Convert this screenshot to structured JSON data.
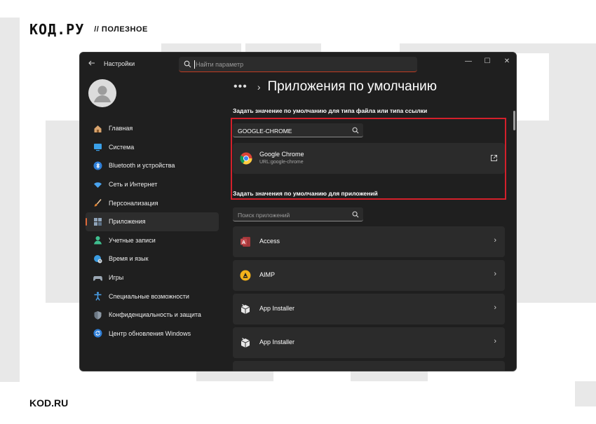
{
  "brand": {
    "logo": "КОД.РУ",
    "tag": "// ПОЛЕЗНОЕ",
    "footer": "KOD.RU"
  },
  "window": {
    "title": "Настройки",
    "search_placeholder": "Найти параметр",
    "controls": {
      "minimize": "—",
      "maximize": "☐",
      "close": "✕"
    }
  },
  "sidebar": {
    "items": [
      {
        "label": "Главная",
        "icon": "home-icon"
      },
      {
        "label": "Система",
        "icon": "monitor-icon"
      },
      {
        "label": "Bluetooth и устройства",
        "icon": "bluetooth-icon"
      },
      {
        "label": "Сеть и Интернет",
        "icon": "wifi-icon"
      },
      {
        "label": "Персонализация",
        "icon": "brush-icon"
      },
      {
        "label": "Приложения",
        "icon": "apps-icon",
        "active": true
      },
      {
        "label": "Учетные записи",
        "icon": "account-icon"
      },
      {
        "label": "Время и язык",
        "icon": "globe-clock-icon"
      },
      {
        "label": "Игры",
        "icon": "gamepad-icon"
      },
      {
        "label": "Специальные возможности",
        "icon": "accessibility-icon"
      },
      {
        "label": "Конфиденциальность и защита",
        "icon": "shield-icon"
      },
      {
        "label": "Центр обновления Windows",
        "icon": "update-icon"
      }
    ]
  },
  "main": {
    "breadcrumb_more": "•••",
    "breadcrumb_sep": "›",
    "title": "Приложения по умолчанию",
    "filetype_section": {
      "label": "Задать значение по умолчанию для типа файла или типа ссылки",
      "search_value": "GOOGLE-CHROME",
      "result": {
        "name": "Google Chrome",
        "detail": "URL:google-chrome"
      }
    },
    "apps_section": {
      "label": "Задать значения по умолчанию для приложений",
      "search_placeholder": "Поиск приложений",
      "apps": [
        {
          "name": "Access",
          "icon": "access-icon"
        },
        {
          "name": "AIMP",
          "icon": "aimp-icon"
        },
        {
          "name": "App Installer",
          "icon": "app-installer-icon"
        },
        {
          "name": "App Installer",
          "icon": "app-installer-icon"
        }
      ]
    }
  },
  "colors": {
    "accent": "#e06a3b",
    "highlight_border": "#d4202b",
    "window_bg": "#1f1f1f",
    "row_bg": "#2b2b2b"
  }
}
